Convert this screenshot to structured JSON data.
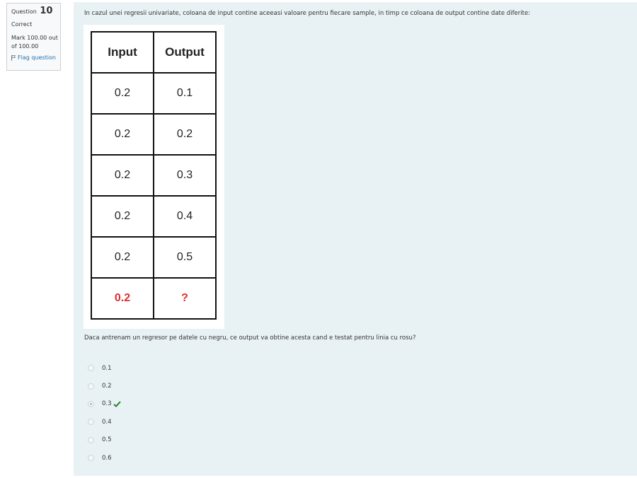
{
  "info": {
    "question_label": "Question",
    "question_number": "10",
    "state": "Correct",
    "grade": "Mark 100.00 out of 100.00",
    "flag_label": "Flag question"
  },
  "question": {
    "text": "In cazul unei regresii univariate, coloana de input contine aceeasi valoare pentru fiecare sample, in timp ce coloana de output contine date diferite:",
    "prompt": "Daca antrenam un regresor pe datele cu negru, ce output va obtine acesta cand e testat pentru linia cu rosu?"
  },
  "table": {
    "headers": [
      "Input",
      "Output"
    ],
    "rows": [
      [
        "0.2",
        "0.1"
      ],
      [
        "0.2",
        "0.2"
      ],
      [
        "0.2",
        "0.3"
      ],
      [
        "0.2",
        "0.4"
      ],
      [
        "0.2",
        "0.5"
      ],
      [
        "0.2",
        "?"
      ]
    ],
    "highlight_row_color": "#e02b2b"
  },
  "answers": {
    "options": [
      "0.1",
      "0.2",
      "0.3",
      "0.4",
      "0.5",
      "0.6"
    ],
    "selected": "0.3",
    "correct_icon": "check-icon",
    "correct_color": "#2e7d32"
  }
}
